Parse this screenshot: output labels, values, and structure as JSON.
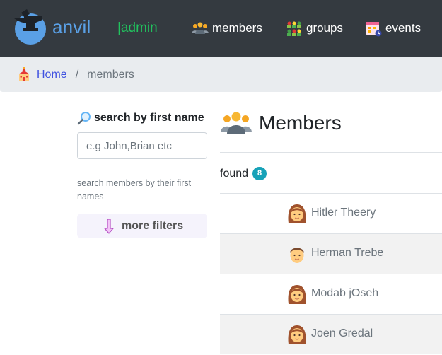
{
  "navbar": {
    "brand": "anvil",
    "admin": "|admin",
    "items": [
      {
        "label": "members",
        "icon": "people-group-icon"
      },
      {
        "label": "groups",
        "icon": "group-network-icon"
      },
      {
        "label": "events",
        "icon": "calendar-event-icon"
      }
    ]
  },
  "breadcrumb": {
    "home": "Home",
    "separator": "/",
    "current": "members"
  },
  "sidebar": {
    "search_title": "search by first name",
    "search_placeholder": "e.g John,Brian etc",
    "search_value": "",
    "help": "search members by their first names",
    "more_filters": "more filters"
  },
  "members": {
    "title": "Members",
    "found_label": "found",
    "count": "8",
    "list": [
      {
        "name": "Hitler Theery",
        "avatar": "woman-icon"
      },
      {
        "name": "Herman Trebe",
        "avatar": "man-icon"
      },
      {
        "name": "Modab jOseh",
        "avatar": "woman-icon"
      },
      {
        "name": "Joen Gredal",
        "avatar": "woman-icon"
      }
    ]
  },
  "colors": {
    "navbar_bg": "#343a40",
    "brand": "#5aa0e6",
    "admin": "#21c25e",
    "breadcrumb_bg": "#e9ecef",
    "link": "#3f51e0",
    "badge": "#17a2b8",
    "row_alt": "#f2f2f2"
  }
}
